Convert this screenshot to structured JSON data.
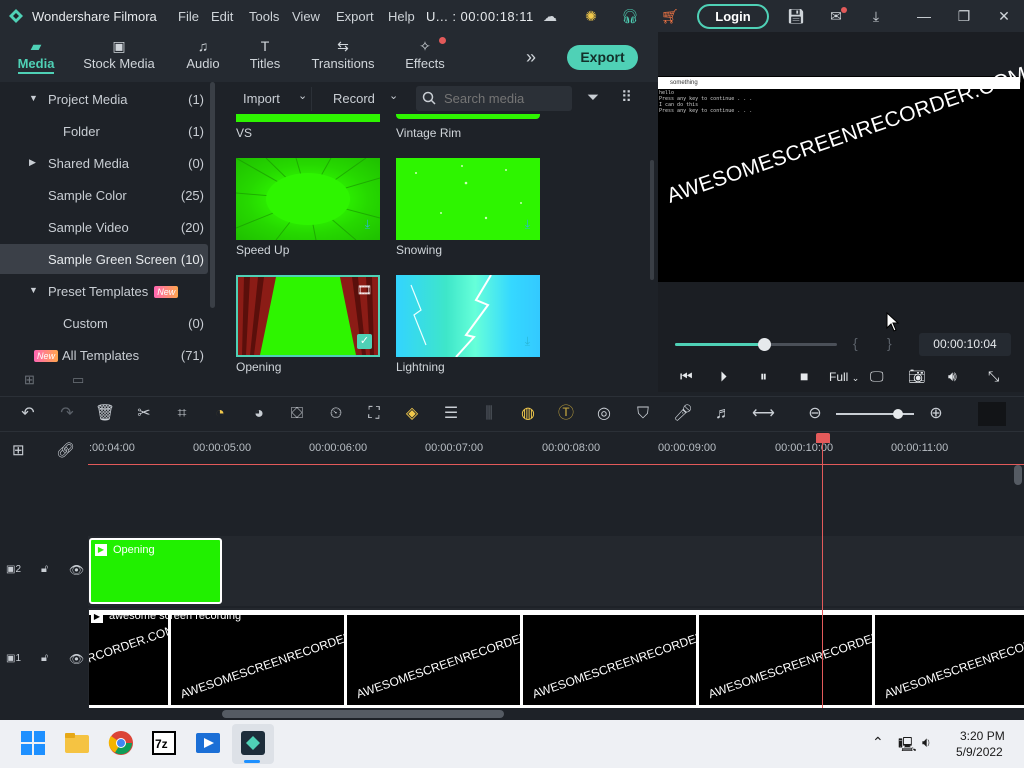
{
  "window": {
    "app_name": "Wondershare Filmora",
    "menus": [
      "File",
      "Edit",
      "Tools",
      "View",
      "Export",
      "Help"
    ],
    "project_title": "U... : 00:00:18:11",
    "login_label": "Login"
  },
  "tabs": [
    {
      "label": "Media",
      "icon": "folder-icon",
      "active": true
    },
    {
      "label": "Stock Media",
      "icon": "stock-media-icon"
    },
    {
      "label": "Audio",
      "icon": "music-note-icon"
    },
    {
      "label": "Titles",
      "icon": "text-t-icon"
    },
    {
      "label": "Transitions",
      "icon": "transition-icon"
    },
    {
      "label": "Effects",
      "icon": "effects-icon"
    }
  ],
  "export_label": "Export",
  "sidebar": {
    "items": [
      {
        "label": "Project Media",
        "count": "(1)",
        "expanded": true
      },
      {
        "label": "Folder",
        "count": "(1)"
      },
      {
        "label": "Shared Media",
        "count": "(0)",
        "expanded": false
      },
      {
        "label": "Sample Color",
        "count": "(25)"
      },
      {
        "label": "Sample Video",
        "count": "(20)"
      },
      {
        "label": "Sample Green Screen",
        "count": "(10)",
        "selected": true
      },
      {
        "label": "Preset Templates",
        "count": "",
        "badge": "New",
        "expanded": true
      },
      {
        "label": "Custom",
        "count": "(0)"
      },
      {
        "label": "All Templates",
        "count": "(71)",
        "badge": "New"
      }
    ]
  },
  "media_toolbar": {
    "import_label": "Import",
    "record_label": "Record",
    "search_placeholder": "Search media"
  },
  "media_items": [
    {
      "label": "VS"
    },
    {
      "label": "Vintage Rim"
    },
    {
      "label": "Speed Up"
    },
    {
      "label": "Snowing"
    },
    {
      "label": "Opening",
      "selected": true
    },
    {
      "label": "Lightning"
    }
  ],
  "preview": {
    "watermark": "AWESOMESCREENRECORDER.COM",
    "window_title": "something",
    "terminal_lines": [
      "hello",
      "Press any key to continue . . .",
      "I can do this",
      "Press any key to continue . . ."
    ],
    "progress": 0.55,
    "timecode": "00:00:10:04",
    "quality": "Full",
    "mark_in": "{",
    "mark_out": "}"
  },
  "timeline": {
    "ruler_labels": [
      ":00:04:00",
      "00:00:05:00",
      "00:00:06:00",
      "00:00:07:00",
      "00:00:08:00",
      "00:00:09:00",
      "00:00:10:00",
      "00:00:11:00"
    ],
    "tracks": [
      {
        "number": "2",
        "clip_label": "Opening"
      },
      {
        "number": "1",
        "clip_label": "awesome screen recording"
      }
    ],
    "frame_watermark": "AWESOMESCREENRECORDER.COM",
    "frame_watermark_cut": "RCORDER.COM"
  },
  "taskbar": {
    "time": "3:20 PM",
    "date": "5/9/2022"
  },
  "colors": {
    "accent": "#4fd1b6",
    "playhead": "#e35a5a",
    "green_screen": "#2ef500"
  }
}
